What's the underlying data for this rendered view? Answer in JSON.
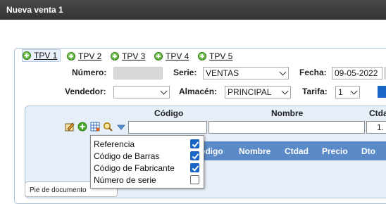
{
  "window": {
    "title": "Nueva venta 1"
  },
  "tabs": [
    "TPV 1",
    "TPV 2",
    "TPV 3",
    "TPV 4",
    "TPV 5"
  ],
  "form": {
    "numero_label": "Número:",
    "serie_label": "Serie:",
    "serie_value": "VENTAS",
    "fecha_label": "Fecha:",
    "fecha_value": "09-05-2022",
    "vendedor_label": "Vendedor:",
    "vendedor_value": "",
    "almacen_label": "Almacén:",
    "almacen_value": "PRINCIPAL",
    "tarifa_label": "Tarifa:",
    "tarifa_value": "1"
  },
  "lines": {
    "codigo_header": "Código",
    "nombre_header": "Nombre",
    "ctdad_header": "Ctda",
    "qty_value": "1.",
    "toolbar_icons": [
      "edit-icon",
      "add-icon",
      "grid-icon",
      "search-icon",
      "dropdown-icon"
    ]
  },
  "table_header": [
    "ódigo",
    "Nombre",
    "Ctdad",
    "Precio",
    "Dto"
  ],
  "search_options": [
    {
      "label": "Referencia",
      "checked": true
    },
    {
      "label": "Código de Barras",
      "checked": true
    },
    {
      "label": "Código de Fabricante",
      "checked": true
    },
    {
      "label": "Número de serie",
      "checked": false
    }
  ],
  "footer": {
    "pie_label": "Pie de documento"
  },
  "colors": {
    "titlebar": "#3a3a3a",
    "accent_blue": "#1a66c7",
    "table_header": "#5b8ac8",
    "panel_bg": "#e6eef8"
  }
}
